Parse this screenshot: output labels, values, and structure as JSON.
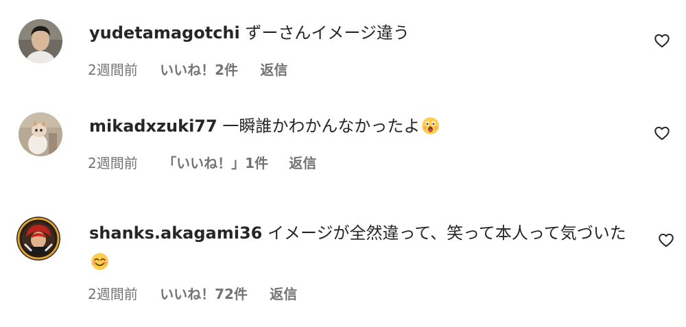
{
  "comments": [
    {
      "username": "yudetamagotchi",
      "text": "ずーさんイメージ違う",
      "time": "2週間前",
      "likes": "いいね！2件",
      "reply": "返信",
      "avatar_icon": "user-photo-avatar",
      "emoji": ""
    },
    {
      "username": "mikadxzuki77",
      "text": "一瞬誰かわかんなかったよ",
      "time": "2週間前",
      "likes": "「いいね！」1件",
      "reply": "返信",
      "avatar_icon": "kitten-photo-avatar",
      "emoji": "astonished-face-emoji"
    },
    {
      "username": "shanks.akagami36",
      "text": "イメージが全然違って、笑って本人って気づいた",
      "time": "2週間前",
      "likes": "いいね！72件",
      "reply": "返信",
      "avatar_icon": "pirate-character-avatar",
      "emoji": "smiling-face-emoji"
    }
  ],
  "colors": {
    "text_primary": "#262626",
    "text_secondary": "#737373",
    "background": "#ffffff"
  },
  "icons": {
    "like": "heart-outline-icon"
  }
}
